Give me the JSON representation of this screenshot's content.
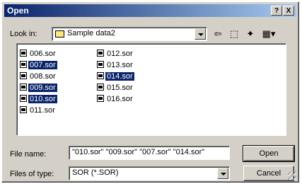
{
  "window": {
    "title": "Open"
  },
  "titlebar": {
    "help_label": "?",
    "close_label": "X"
  },
  "look_in": {
    "label": "Look in:",
    "value": "Sample data2"
  },
  "toolbar": {
    "back_glyph": "⇦",
    "up_glyph": "⬚",
    "newfolder_glyph": "✦",
    "views_glyph": "▦▾"
  },
  "files": [
    {
      "name": "006.sor",
      "selected": false
    },
    {
      "name": "007.sor",
      "selected": true
    },
    {
      "name": "008.sor",
      "selected": false
    },
    {
      "name": "009.sor",
      "selected": true
    },
    {
      "name": "010.sor",
      "selected": true
    },
    {
      "name": "011.sor",
      "selected": false
    },
    {
      "name": "012.sor",
      "selected": false
    },
    {
      "name": "013.sor",
      "selected": false
    },
    {
      "name": "014.sor",
      "selected": true
    },
    {
      "name": "015.sor",
      "selected": false
    },
    {
      "name": "016.sor",
      "selected": false
    }
  ],
  "file_name": {
    "label": "File name:",
    "value": "\"010.sor\" \"009.sor\" \"007.sor\" \"014.sor\""
  },
  "file_type": {
    "label": "Files of type:",
    "value": "SOR (*.SOR)"
  },
  "buttons": {
    "open": "Open",
    "cancel": "Cancel"
  },
  "colors": {
    "title_start": "#0a246a",
    "title_end": "#a6caf0",
    "selection": "#0a246a",
    "face": "#d4d0c8"
  }
}
